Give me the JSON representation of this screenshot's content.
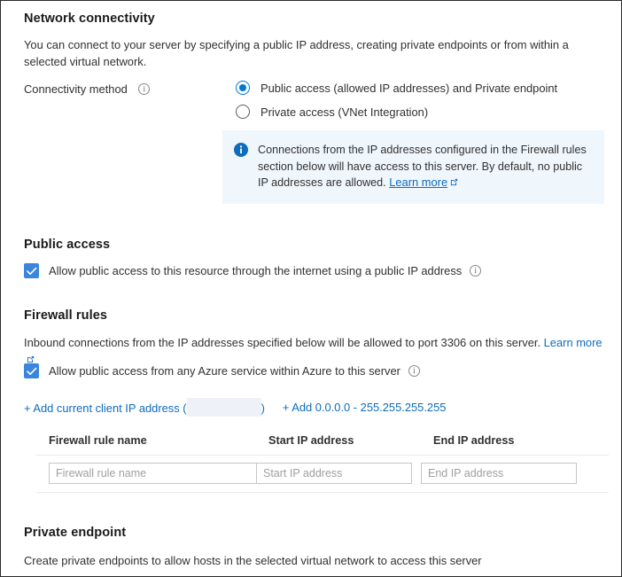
{
  "network_connectivity": {
    "title": "Network connectivity",
    "description": "You can connect to your server by specifying a public IP address, creating private endpoints or from within a selected virtual network.",
    "connectivity_method_label": "Connectivity method",
    "options": [
      {
        "label": "Public access (allowed IP addresses) and Private endpoint",
        "selected": true
      },
      {
        "label": "Private access (VNet Integration)",
        "selected": false
      }
    ],
    "info_banner": {
      "text": "Connections from the IP addresses configured in the Firewall rules section below will have access to this server. By default, no public IP addresses are allowed. ",
      "link_label": "Learn more"
    }
  },
  "public_access": {
    "title": "Public access",
    "checkbox_label": "Allow public access to this resource through the internet using a public IP address",
    "checked": true
  },
  "firewall_rules": {
    "title": "Firewall rules",
    "description": "Inbound connections from the IP addresses specified below will be allowed to port 3306 on this server. ",
    "learn_more_label": "Learn more",
    "azure_checkbox_label": "Allow public access from any Azure service within Azure to this server",
    "azure_checked": true,
    "add_client_ip_prefix": "+ Add current client IP address (",
    "add_client_ip_suffix": ")",
    "add_client_ip_value": "",
    "add_all_ips_label": "+ Add 0.0.0.0 - 255.255.255.255",
    "columns": [
      "Firewall rule name",
      "Start IP address",
      "End IP address"
    ],
    "rows": [
      {
        "name_value": "",
        "name_placeholder": "Firewall rule name",
        "start_value": "",
        "start_placeholder": "Start IP address",
        "end_value": "",
        "end_placeholder": "End IP address"
      }
    ]
  },
  "private_endpoint": {
    "title": "Private endpoint",
    "description": "Create private endpoints to allow hosts in the selected virtual network to access this server"
  },
  "colors": {
    "accent": "#0078d4",
    "link": "#0f6cbd",
    "checkbox_fill": "#3b86dd",
    "info_banner_bg": "#eff6fc",
    "redaction": "#eef1f8",
    "divider": "#edebe9",
    "input_border": "#c8c6c4"
  }
}
